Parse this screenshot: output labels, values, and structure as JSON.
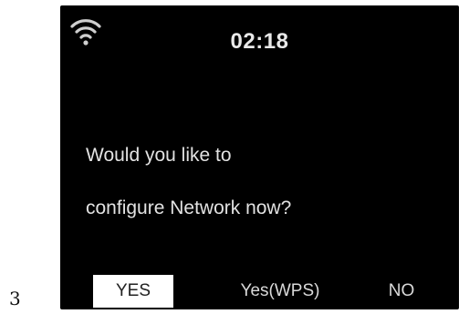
{
  "figure_number": "3",
  "status_bar": {
    "wifi_icon": "wifi-icon",
    "time": "02:18"
  },
  "dialog": {
    "line1": "Would you like to",
    "line2": "configure Network now?"
  },
  "options": {
    "yes": "YES",
    "yes_wps": "Yes(WPS)",
    "no": "NO",
    "selected": "YES"
  },
  "colors": {
    "screen_background": "#000000",
    "text": "#e2e2e2",
    "selection_background": "#ffffff",
    "selection_text": "#222222"
  }
}
